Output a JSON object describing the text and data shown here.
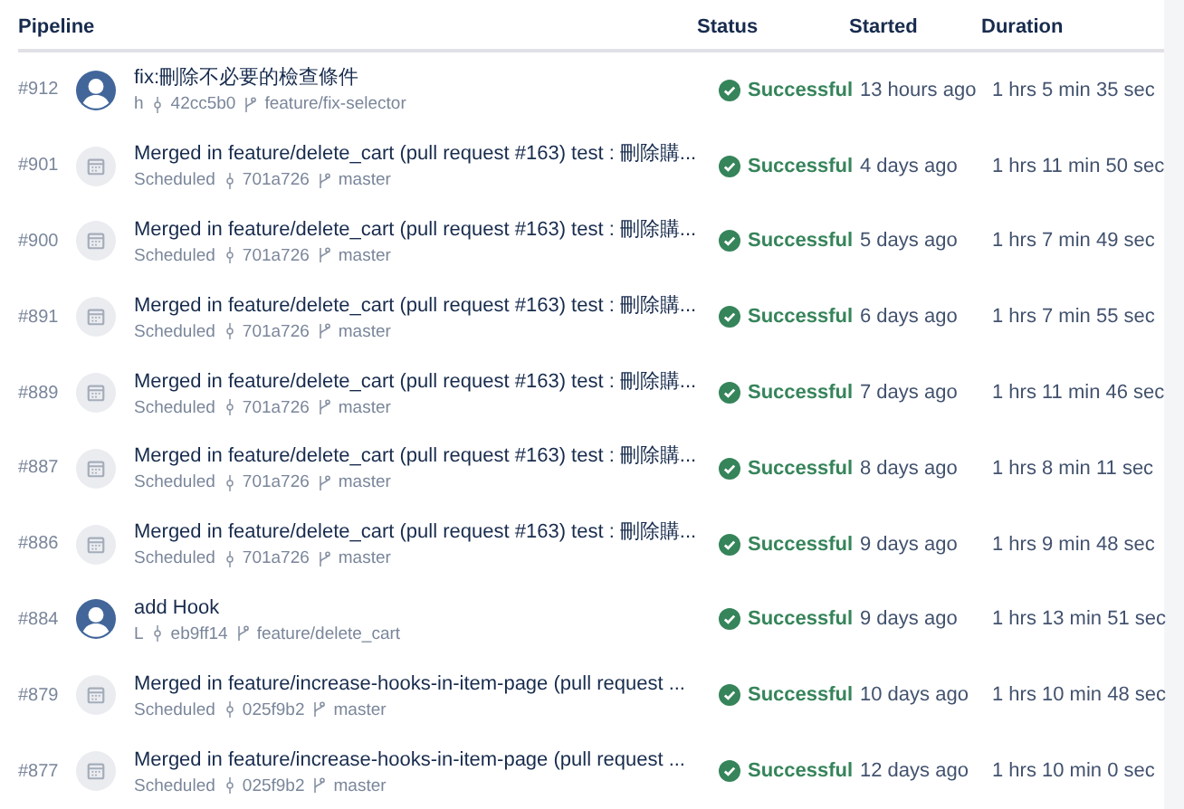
{
  "columns": [
    "Pipeline",
    "Status",
    "Started",
    "Duration"
  ],
  "rows": [
    {
      "number": "#912",
      "kind": "user",
      "title": "fix:刪除不必要的檢查條件",
      "author": "h",
      "commit": "42cc5b0",
      "branch": "feature/fix-selector",
      "status": "Successful",
      "started": "13 hours ago",
      "duration": "1 hrs 5 min 35 sec"
    },
    {
      "number": "#901",
      "kind": "scheduled",
      "title": "Merged in feature/delete_cart (pull request #163) test : 刪除購...",
      "author": "Scheduled",
      "commit": "701a726",
      "branch": "master",
      "status": "Successful",
      "started": "4 days ago",
      "duration": "1 hrs 11 min 50 sec"
    },
    {
      "number": "#900",
      "kind": "scheduled",
      "title": "Merged in feature/delete_cart (pull request #163) test : 刪除購...",
      "author": "Scheduled",
      "commit": "701a726",
      "branch": "master",
      "status": "Successful",
      "started": "5 days ago",
      "duration": "1 hrs 7 min 49 sec"
    },
    {
      "number": "#891",
      "kind": "scheduled",
      "title": "Merged in feature/delete_cart (pull request #163) test : 刪除購...",
      "author": "Scheduled",
      "commit": "701a726",
      "branch": "master",
      "status": "Successful",
      "started": "6 days ago",
      "duration": "1 hrs 7 min 55 sec"
    },
    {
      "number": "#889",
      "kind": "scheduled",
      "title": "Merged in feature/delete_cart (pull request #163) test : 刪除購...",
      "author": "Scheduled",
      "commit": "701a726",
      "branch": "master",
      "status": "Successful",
      "started": "7 days ago",
      "duration": "1 hrs 11 min 46 sec"
    },
    {
      "number": "#887",
      "kind": "scheduled",
      "title": "Merged in feature/delete_cart (pull request #163) test : 刪除購...",
      "author": "Scheduled",
      "commit": "701a726",
      "branch": "master",
      "status": "Successful",
      "started": "8 days ago",
      "duration": "1 hrs 8 min 11 sec"
    },
    {
      "number": "#886",
      "kind": "scheduled",
      "title": "Merged in feature/delete_cart (pull request #163) test : 刪除購...",
      "author": "Scheduled",
      "commit": "701a726",
      "branch": "master",
      "status": "Successful",
      "started": "9 days ago",
      "duration": "1 hrs 9 min 48 sec"
    },
    {
      "number": "#884",
      "kind": "user",
      "title": "add Hook",
      "author": "L",
      "commit": "eb9ff14",
      "branch": "feature/delete_cart",
      "status": "Successful",
      "started": "9 days ago",
      "duration": "1 hrs 13 min 51 sec"
    },
    {
      "number": "#879",
      "kind": "scheduled",
      "title": "Merged in feature/increase-hooks-in-item-page (pull request ...",
      "author": "Scheduled",
      "commit": "025f9b2",
      "branch": "master",
      "status": "Successful",
      "started": "10 days ago",
      "duration": "1 hrs 10 min 48 sec"
    },
    {
      "number": "#877",
      "kind": "scheduled",
      "title": "Merged in feature/increase-hooks-in-item-page (pull request ...",
      "author": "Scheduled",
      "commit": "025f9b2",
      "branch": "master",
      "status": "Successful",
      "started": "12 days ago",
      "duration": "1 hrs 10 min 0 sec"
    }
  ]
}
